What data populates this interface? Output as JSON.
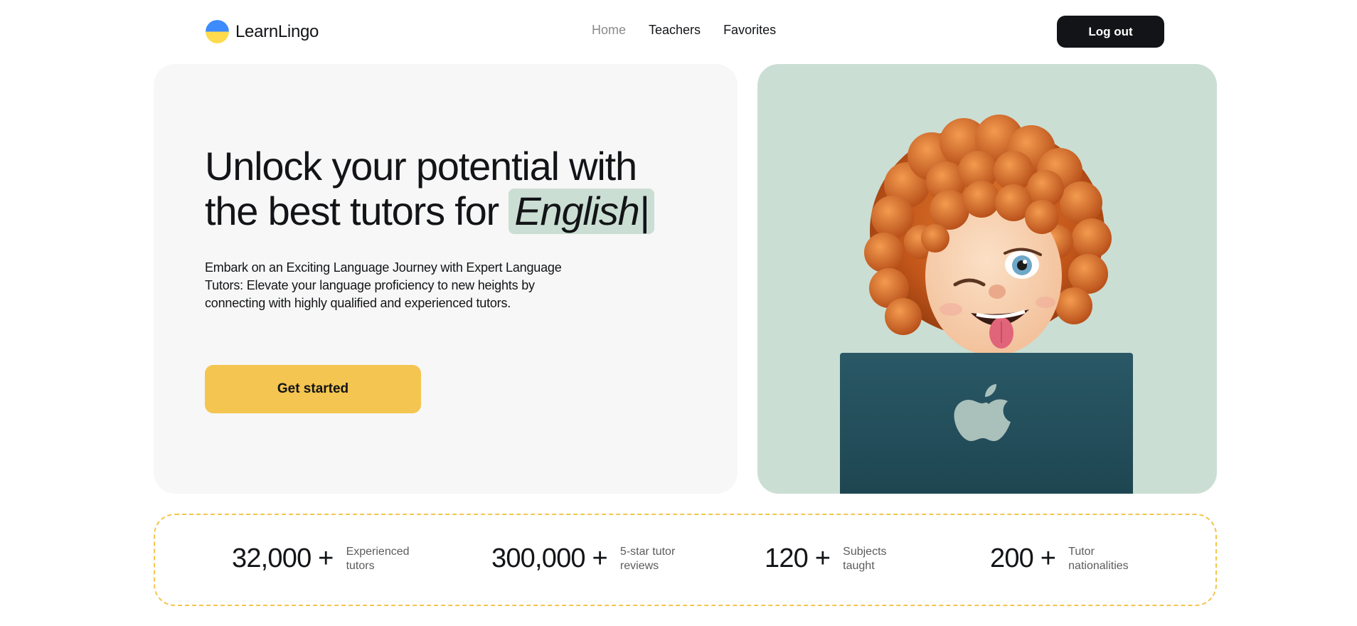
{
  "brand": {
    "name": "LearnLingo",
    "logo_colors": {
      "top": "#3d8bfd",
      "bottom": "#ffdb4d"
    }
  },
  "nav": {
    "items": [
      {
        "label": "Home",
        "active": true
      },
      {
        "label": "Teachers",
        "active": false
      },
      {
        "label": "Favorites",
        "active": false
      }
    ],
    "logout_label": "Log out"
  },
  "hero": {
    "title_prefix": "Unlock your potential with the best tutors for",
    "title_highlight": "English|",
    "description": "Embark on an Exciting Language Journey with Expert Language Tutors: Elevate your language proficiency to new heights by connecting with highly qualified and experienced tutors.",
    "cta_label": "Get started",
    "illustration": "memoji-girl-with-laptop"
  },
  "stats": [
    {
      "value": "32,000 +",
      "label": "Experienced\ntutors"
    },
    {
      "value": "300,000 +",
      "label": "5-star tutor\nreviews"
    },
    {
      "value": "120 +",
      "label": "Subjects\ntaught"
    },
    {
      "value": "200 +",
      "label": "Tutor\nnationalities"
    }
  ],
  "colors": {
    "accent": "#f4c550",
    "accent_soft": "#cbded3",
    "text": "#121417",
    "panel": "#f7f7f7",
    "button_dark": "#121417"
  }
}
